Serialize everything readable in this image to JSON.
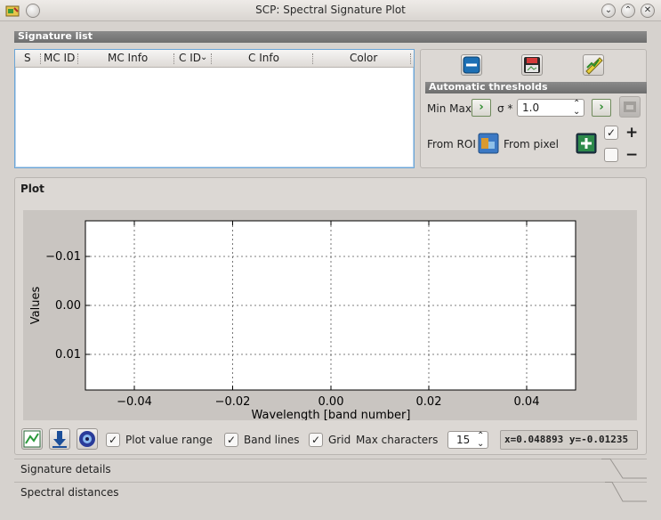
{
  "window": {
    "title": "SCP: Spectral Signature Plot"
  },
  "signature_list": {
    "header": "Signature list",
    "columns": [
      "S",
      "MC ID",
      "MC Info",
      "C ID",
      "C Info",
      "Color"
    ],
    "rows": []
  },
  "tools": {
    "header": "Automatic thresholds",
    "minmax_label": "Min Max",
    "sigma_label": "σ *",
    "sigma_value": "1.0",
    "from_roi_label": "From ROI",
    "from_pixel_label": "From pixel",
    "plus_label": "+",
    "minus_label": "−"
  },
  "plot": {
    "header": "Plot",
    "xlabel": "Wavelength [band number]",
    "ylabel": "Values",
    "x_ticks": [
      "−0.04",
      "−0.02",
      "0.00",
      "0.02",
      "0.04"
    ],
    "y_ticks": [
      "−0.01",
      "0.00",
      "0.01"
    ]
  },
  "controls": {
    "plot_value_range_label": "Plot value range",
    "band_lines_label": "Band lines",
    "grid_label": "Grid",
    "max_chars_label": "Max characters",
    "max_chars_value": "15",
    "coord_readout": "x=0.048893 y=-0.01235"
  },
  "tabs": {
    "signature_details": "Signature details",
    "spectral_distances": "Spectral distances"
  }
}
